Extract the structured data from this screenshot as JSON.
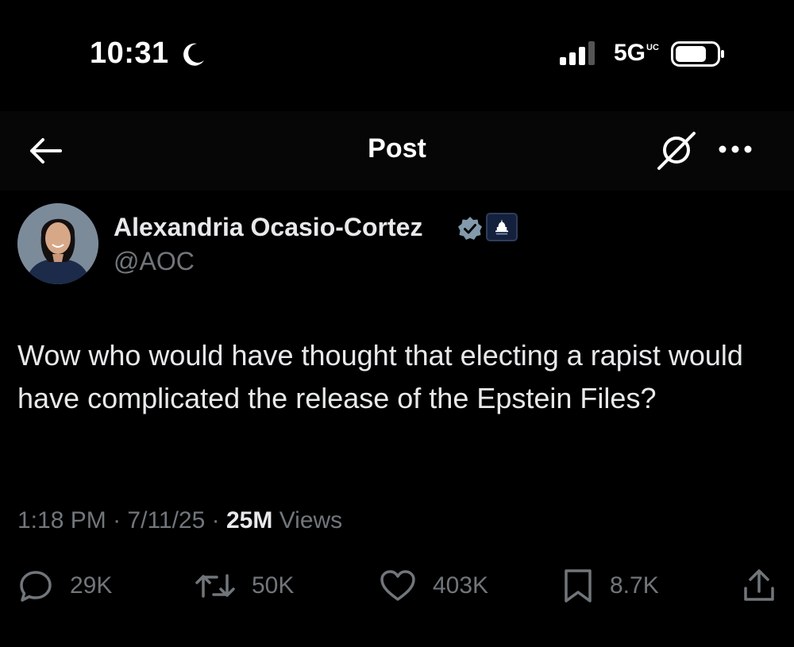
{
  "status_bar": {
    "time": "10:31",
    "moon_icon": "moon-icon",
    "signal_icon": "signal-bars-icon",
    "network": "5G",
    "network_suffix": "UC",
    "battery_icon": "battery-icon"
  },
  "nav": {
    "back_icon": "arrow-left-icon",
    "title": "Post",
    "grok_icon": "grok-icon",
    "more_icon": "ellipsis-icon"
  },
  "post": {
    "author_name": "Alexandria Ocasio-Cortez",
    "author_handle": "@AOC",
    "verified_icon": "verified-badge-icon",
    "affiliate_icon": "capitol-badge-icon",
    "text": "Wow who would have thought that electing a rapist would have complicated the release of the Epstein Files?",
    "time": "1:18 PM",
    "separator": "·",
    "date": "7/11/25",
    "views_count": "25M",
    "views_label": "Views"
  },
  "actions": {
    "reply_count": "29K",
    "repost_count": "50K",
    "like_count": "403K",
    "bookmark_count": "8.7K",
    "share_icon": "share-icon"
  },
  "colors": {
    "background": "#000000",
    "text_primary": "#e7e9ea",
    "text_secondary": "#71767b",
    "verified": "#829aab"
  }
}
